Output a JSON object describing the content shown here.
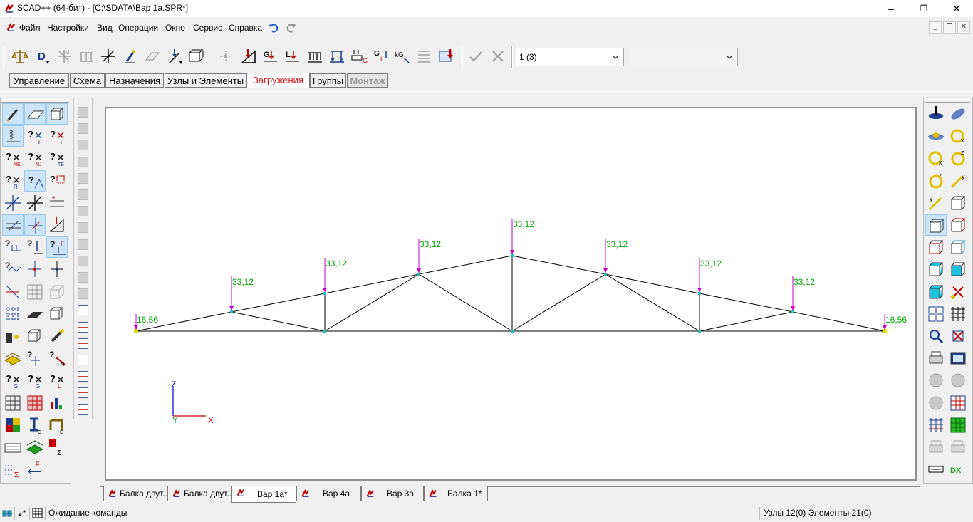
{
  "window": {
    "title": "SCAD++ (64-бит) - [C:\\SDATA\\Вар 1a.SPR*]",
    "minimize": "–",
    "maximize": "❐",
    "close": "✕"
  },
  "menu": {
    "items": [
      "Файл",
      "Настройки",
      "Вид",
      "Операции",
      "Окно",
      "Сервис",
      "Справка"
    ],
    "undo_icon": "undo-icon",
    "redo_icon": "redo-icon"
  },
  "mdi_controls": {
    "minimize": "_",
    "restore": "❐",
    "close": "✕"
  },
  "toolbar": {
    "load_case_select": "1 (3)",
    "second_select": ""
  },
  "ribbon_tabs": {
    "items": [
      "Управление",
      "Схема",
      "Назначения",
      "Узлы и Элементы",
      "Загружения",
      "Группы",
      "Монтаж"
    ],
    "active": "Загружения"
  },
  "model": {
    "loads": [
      {
        "label": "16,56"
      },
      {
        "label": "33,12"
      },
      {
        "label": "33,12"
      },
      {
        "label": "33,12"
      },
      {
        "label": "33,12"
      },
      {
        "label": "33,12"
      },
      {
        "label": "33,12"
      },
      {
        "label": "33,12"
      },
      {
        "label": "16,56"
      }
    ],
    "axes": {
      "z": "Z",
      "y": "Y",
      "x": "X"
    },
    "colors": {
      "members": "#000000",
      "loads": "#cc00cc",
      "labels": "#00aa00",
      "axis_z": "#0000cc",
      "axis_x": "#cc0000",
      "axis_y": "#00aa00"
    }
  },
  "doc_tabs": {
    "items": [
      "Балка двут...",
      "Балка двут...",
      "Вар 1a*",
      "Вар 4a",
      "Вар 3a",
      "Балка 1*"
    ],
    "active": "Вар 1a*"
  },
  "status": {
    "message": "Ожидание команды",
    "info": "Узлы 12(0) Элементы 21(0)"
  }
}
